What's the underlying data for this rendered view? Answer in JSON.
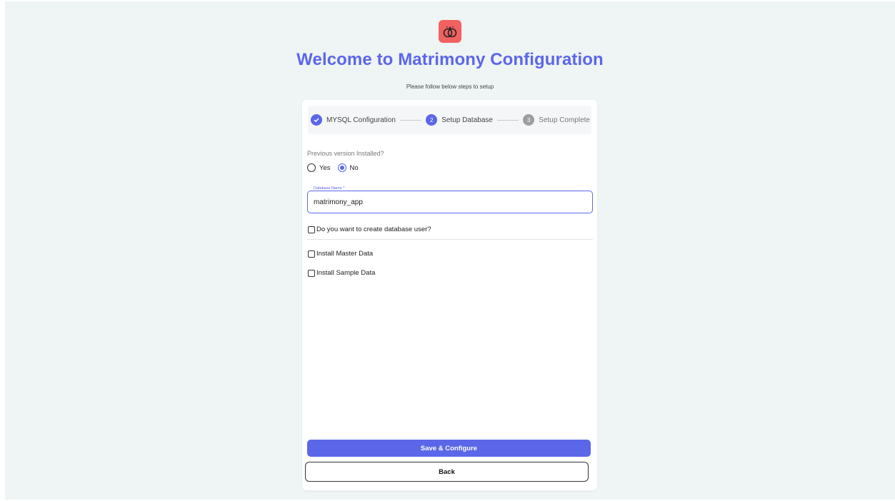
{
  "header": {
    "logo_icon": "wedding-rings-icon",
    "title": "Welcome to Matrimony Configuration",
    "subtitle": "Please follow below steps to setup"
  },
  "stepper": {
    "steps": [
      {
        "num": "",
        "label": "MYSQL Configuration",
        "state": "done"
      },
      {
        "num": "2",
        "label": "Setup Database",
        "state": "active"
      },
      {
        "num": "3",
        "label": "Setup Complete",
        "state": "pending"
      }
    ]
  },
  "form": {
    "previous_version_label": "Previous version Installed?",
    "radio_yes": "Yes",
    "radio_no": "No",
    "selected": "No",
    "db_name_label": "Database Name *",
    "db_name_value": "matrimony_app",
    "create_user_label": "Do you want to create database user?",
    "master_data_label": "Install Master Data",
    "sample_data_label": "Install Sample Data"
  },
  "actions": {
    "save_label": "Save & Configure",
    "back_label": "Back"
  },
  "colors": {
    "accent": "#5b67e8",
    "logo_bg": "#f26161",
    "page_bg": "#eff4f4"
  }
}
